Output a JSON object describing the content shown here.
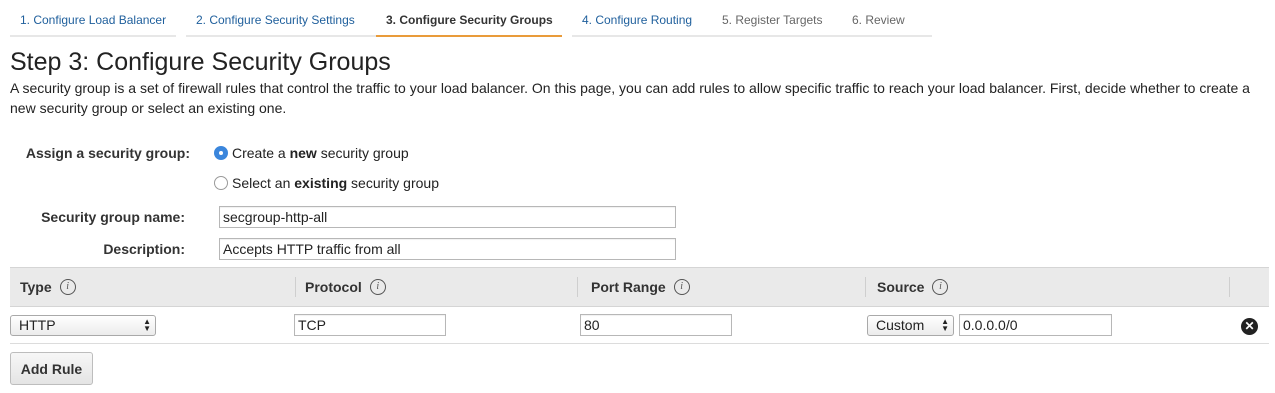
{
  "wizard": {
    "tabs": [
      {
        "label": "1. Configure Load Balancer",
        "state": "link"
      },
      {
        "label": "2. Configure Security Settings",
        "state": "link"
      },
      {
        "label": "3. Configure Security Groups",
        "state": "active"
      },
      {
        "label": "4. Configure Routing",
        "state": "link"
      },
      {
        "label": "5. Register Targets",
        "state": "disabled"
      },
      {
        "label": "6. Review",
        "state": "disabled"
      }
    ]
  },
  "page": {
    "title": "Step 3: Configure Security Groups",
    "description": "A security group is a set of firewall rules that control the traffic to your load balancer. On this page, you can add rules to allow specific traffic to reach your load balancer. First, decide whether to create a new security group or select an existing one."
  },
  "assign": {
    "label": "Assign a security group:",
    "option_new": {
      "prefix": "Create a ",
      "bold": "new",
      "suffix": " security group",
      "selected": true
    },
    "option_existing": {
      "prefix": "Select an ",
      "bold": "existing",
      "suffix": " security group",
      "selected": false
    }
  },
  "form": {
    "name_label": "Security group name:",
    "name_value": "secgroup-http-all",
    "description_label": "Description:",
    "description_value": "Accepts HTTP traffic from all"
  },
  "rules_table": {
    "headers": [
      "Type",
      "Protocol",
      "Port Range",
      "Source"
    ],
    "info_glyph": "i",
    "rows": [
      {
        "type": "HTTP",
        "protocol": "TCP",
        "port_range": "80",
        "source_mode": "Custom",
        "source_value": "0.0.0.0/0"
      }
    ],
    "remove_icon": "remove-circle-icon"
  },
  "add_rule_label": "Add Rule",
  "colors": {
    "link": "#1f5f9c",
    "active_tab_underline": "#e99b3a",
    "radio_selected": "#3b86dc",
    "header_bg": "#eaeaea"
  }
}
